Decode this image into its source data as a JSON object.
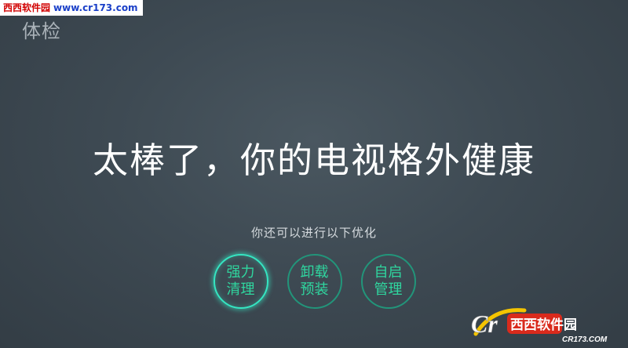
{
  "watermark": {
    "site_name": "西西软件园",
    "url": "www.cr173.com"
  },
  "page": {
    "title": "体检"
  },
  "result": {
    "headline": "太棒了，你的电视格外健康",
    "subtitle": "你还可以进行以下优化"
  },
  "options": [
    {
      "line1": "强力",
      "line2": "清理",
      "selected": true
    },
    {
      "line1": "卸载",
      "line2": "预装",
      "selected": false
    },
    {
      "line1": "自启",
      "line2": "管理",
      "selected": false
    }
  ],
  "brand_logo": {
    "prefix": "Cr",
    "name": "西西软件园",
    "url": "CR173.COM"
  },
  "colors": {
    "accent": "#2fd69f",
    "ring": "#22957a",
    "ring_active": "#35e6c2"
  }
}
